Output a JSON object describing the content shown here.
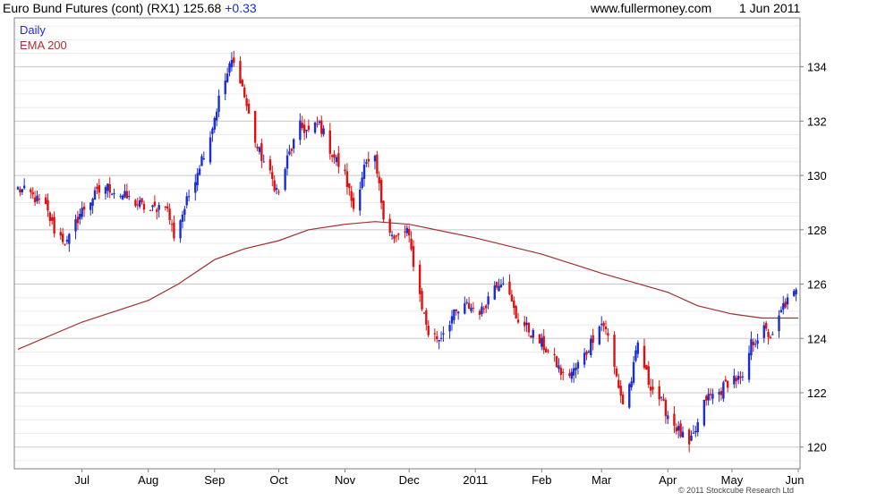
{
  "header": {
    "instrument": "Euro Bund Futures (cont) (RX1) 125.68",
    "change": "+0.33",
    "site": "www.fullermoney.com",
    "date": "1 Jun 2011"
  },
  "legend": {
    "daily": "Daily",
    "ema": "EMA 200"
  },
  "copyright": "© 2011 Stockcube Research Ltd",
  "colors": {
    "up": "#1a2cd6",
    "down": "#e01010",
    "ema": "#a03030",
    "grid_major": "#c8c8c8",
    "grid_minor": "#ececec"
  },
  "chart_data": {
    "type": "candlestick",
    "title": "Euro Bund Futures (cont) (RX1) 125.68 +0.33",
    "xlabel": "",
    "ylabel": "",
    "ylim": [
      119.2,
      135.8
    ],
    "yticks": [
      120,
      122,
      124,
      126,
      128,
      130,
      132,
      134
    ],
    "xticks": [
      "Jul",
      "Aug",
      "Sep",
      "Oct",
      "Nov",
      "Dec",
      "2011",
      "Feb",
      "Mar",
      "Apr",
      "May",
      "Jun"
    ],
    "x_range": [
      "2010-06-01",
      "2011-06-01"
    ],
    "grid": true,
    "legend_position": "top-left",
    "series": [
      {
        "name": "Daily",
        "kind": "close",
        "points": [
          [
            "2010-06-01",
            129.5
          ],
          [
            "2010-06-07",
            129.3
          ],
          [
            "2010-06-14",
            128.8
          ],
          [
            "2010-06-18",
            128.0
          ],
          [
            "2010-06-24",
            127.5
          ],
          [
            "2010-06-30",
            128.6
          ],
          [
            "2010-07-06",
            129.2
          ],
          [
            "2010-07-12",
            129.6
          ],
          [
            "2010-07-19",
            129.3
          ],
          [
            "2010-07-26",
            129.0
          ],
          [
            "2010-08-02",
            128.7
          ],
          [
            "2010-08-09",
            129.0
          ],
          [
            "2010-08-13",
            127.8
          ],
          [
            "2010-08-18",
            128.8
          ],
          [
            "2010-08-24",
            130.2
          ],
          [
            "2010-08-30",
            131.5
          ],
          [
            "2010-09-03",
            132.8
          ],
          [
            "2010-09-06",
            133.5
          ],
          [
            "2010-09-09",
            134.2
          ],
          [
            "2010-09-13",
            133.6
          ],
          [
            "2010-09-17",
            132.2
          ],
          [
            "2010-09-21",
            131.0
          ],
          [
            "2010-09-27",
            130.0
          ],
          [
            "2010-10-01",
            129.3
          ],
          [
            "2010-10-05",
            130.6
          ],
          [
            "2010-10-11",
            131.8
          ],
          [
            "2010-10-15",
            131.6
          ],
          [
            "2010-10-20",
            131.9
          ],
          [
            "2010-10-26",
            130.8
          ],
          [
            "2010-11-01",
            130.0
          ],
          [
            "2010-11-05",
            128.8
          ],
          [
            "2010-11-10",
            130.3
          ],
          [
            "2010-11-15",
            130.5
          ],
          [
            "2010-11-19",
            128.6
          ],
          [
            "2010-11-24",
            127.6
          ],
          [
            "2010-11-30",
            128.0
          ],
          [
            "2010-12-03",
            126.8
          ],
          [
            "2010-12-07",
            125.2
          ],
          [
            "2010-12-10",
            124.2
          ],
          [
            "2010-12-15",
            124.0
          ],
          [
            "2010-12-21",
            124.8
          ],
          [
            "2010-12-28",
            125.2
          ],
          [
            "2011-01-04",
            125.0
          ],
          [
            "2011-01-10",
            126.0
          ],
          [
            "2011-01-14",
            126.2
          ],
          [
            "2011-01-20",
            124.8
          ],
          [
            "2011-01-26",
            124.3
          ],
          [
            "2011-02-01",
            123.8
          ],
          [
            "2011-02-07",
            123.2
          ],
          [
            "2011-02-11",
            122.6
          ],
          [
            "2011-02-16",
            122.8
          ],
          [
            "2011-02-22",
            123.5
          ],
          [
            "2011-02-28",
            124.6
          ],
          [
            "2011-03-03",
            124.4
          ],
          [
            "2011-03-07",
            122.9
          ],
          [
            "2011-03-11",
            121.6
          ],
          [
            "2011-03-15",
            122.5
          ],
          [
            "2011-03-18",
            123.8
          ],
          [
            "2011-03-23",
            122.4
          ],
          [
            "2011-03-28",
            121.8
          ],
          [
            "2011-04-01",
            121.2
          ],
          [
            "2011-04-06",
            120.6
          ],
          [
            "2011-04-11",
            120.0
          ],
          [
            "2011-04-14",
            120.6
          ],
          [
            "2011-04-19",
            121.8
          ],
          [
            "2011-04-25",
            122.0
          ],
          [
            "2011-05-01",
            122.6
          ],
          [
            "2011-05-06",
            122.4
          ],
          [
            "2011-05-10",
            123.8
          ],
          [
            "2011-05-16",
            124.3
          ],
          [
            "2011-05-20",
            124.0
          ],
          [
            "2011-05-25",
            125.2
          ],
          [
            "2011-05-31",
            125.68
          ]
        ]
      },
      {
        "name": "EMA 200",
        "kind": "line",
        "points": [
          [
            "2010-06-01",
            123.6
          ],
          [
            "2010-07-01",
            124.6
          ],
          [
            "2010-08-01",
            125.4
          ],
          [
            "2010-08-15",
            126.0
          ],
          [
            "2010-09-01",
            126.9
          ],
          [
            "2010-09-15",
            127.3
          ],
          [
            "2010-10-01",
            127.6
          ],
          [
            "2010-10-15",
            128.0
          ],
          [
            "2010-11-01",
            128.2
          ],
          [
            "2010-11-15",
            128.3
          ],
          [
            "2010-12-01",
            128.2
          ],
          [
            "2011-01-01",
            127.7
          ],
          [
            "2011-02-01",
            127.1
          ],
          [
            "2011-03-01",
            126.4
          ],
          [
            "2011-04-01",
            125.7
          ],
          [
            "2011-04-15",
            125.2
          ],
          [
            "2011-05-01",
            124.9
          ],
          [
            "2011-05-15",
            124.75
          ],
          [
            "2011-06-01",
            124.75
          ]
        ]
      }
    ]
  }
}
